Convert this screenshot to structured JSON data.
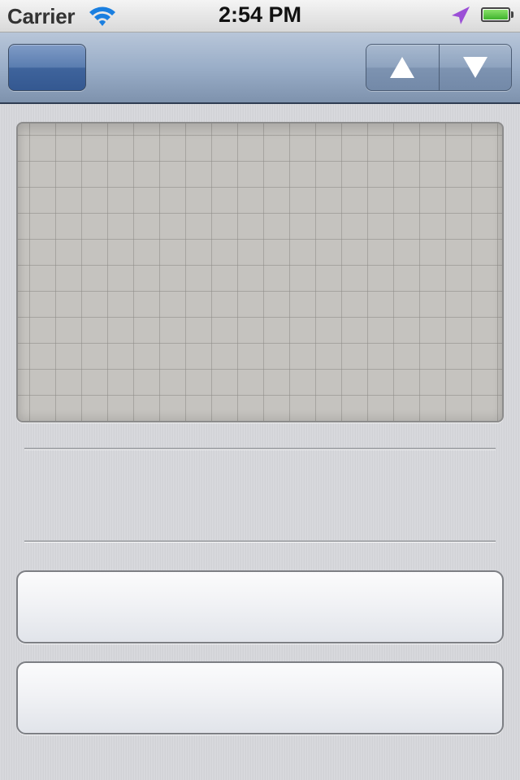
{
  "status_bar": {
    "carrier": "Carrier",
    "time": "2:54 PM",
    "icons": [
      "wifi-icon",
      "location-arrow-icon",
      "battery-icon"
    ],
    "battery_level": 1.0
  },
  "nav_bar": {
    "left_button_label": "",
    "segmented_control": {
      "items": [
        "arrow-up-icon",
        "arrow-down-icon"
      ]
    }
  },
  "colors": {
    "nav_bar": "#9aaec8",
    "nav_button": "#4a6fa5",
    "background": "#d5d6da",
    "grid_panel": "#c5c3bf",
    "battery": "#4cc23a",
    "location_arrow": "#9b4fd6"
  }
}
